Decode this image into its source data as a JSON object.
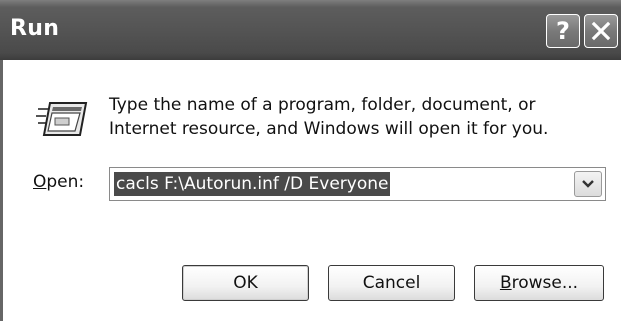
{
  "window": {
    "title": "Run"
  },
  "titlebar": {
    "help_label": "?",
    "help_icon": "help-icon",
    "close_icon": "close-icon"
  },
  "dialog": {
    "icon": "run-program-icon",
    "description_line1": "Type the name of a program, folder, document, or",
    "description_line2": "Internet resource, and Windows will open it for you.",
    "open_label_accel": "O",
    "open_label_rest": "pen:",
    "open_value": "cacls F:\\Autorun.inf /D Everyone",
    "dropdown_icon": "chevron-down-icon"
  },
  "buttons": {
    "ok_label": "OK",
    "cancel_label": "Cancel",
    "browse_accel": "B",
    "browse_rest": "rowse..."
  }
}
